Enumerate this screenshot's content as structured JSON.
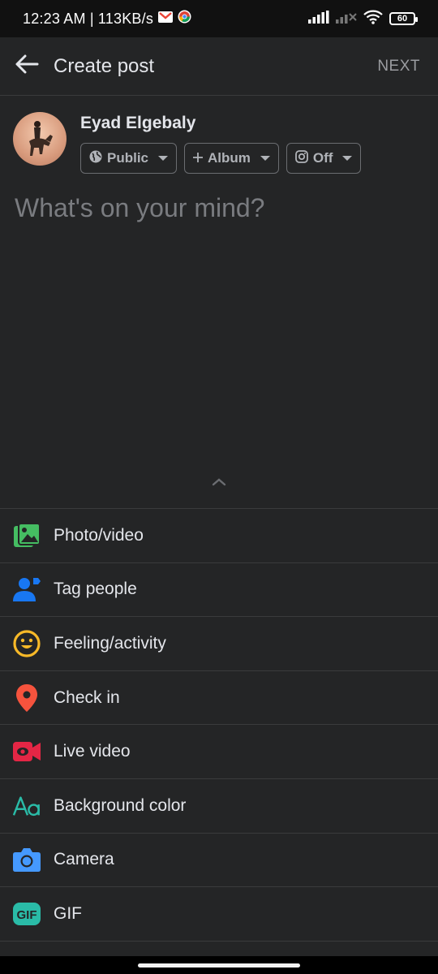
{
  "status_bar": {
    "time": "12:23 AM | 113KB/s",
    "battery": "60"
  },
  "header": {
    "title": "Create post",
    "next_label": "NEXT"
  },
  "composer": {
    "author_name": "Eyad Elgebaly",
    "chips": {
      "privacy": "Public",
      "album": "Album",
      "instagram": "Off"
    },
    "placeholder": "What's on your mind?"
  },
  "options": [
    {
      "label": "Photo/video",
      "icon": "photo-video-icon",
      "color": "#45bd62"
    },
    {
      "label": "Tag people",
      "icon": "tag-people-icon",
      "color": "#1877f2"
    },
    {
      "label": "Feeling/activity",
      "icon": "feeling-icon",
      "color": "#f7b928"
    },
    {
      "label": "Check in",
      "icon": "location-pin-icon",
      "color": "#f5533d"
    },
    {
      "label": "Live video",
      "icon": "live-video-icon",
      "color": "#e42645"
    },
    {
      "label": "Background color",
      "icon": "background-color-icon",
      "color": "#2abba7"
    },
    {
      "label": "Camera",
      "icon": "camera-icon",
      "color": "#4599ff"
    },
    {
      "label": "GIF",
      "icon": "gif-icon",
      "color": "#2abba7"
    }
  ],
  "colors": {
    "surface": "#242526",
    "divider": "#3a3b3c",
    "text": "#e4e6eb",
    "muted": "#b0b3b8"
  }
}
